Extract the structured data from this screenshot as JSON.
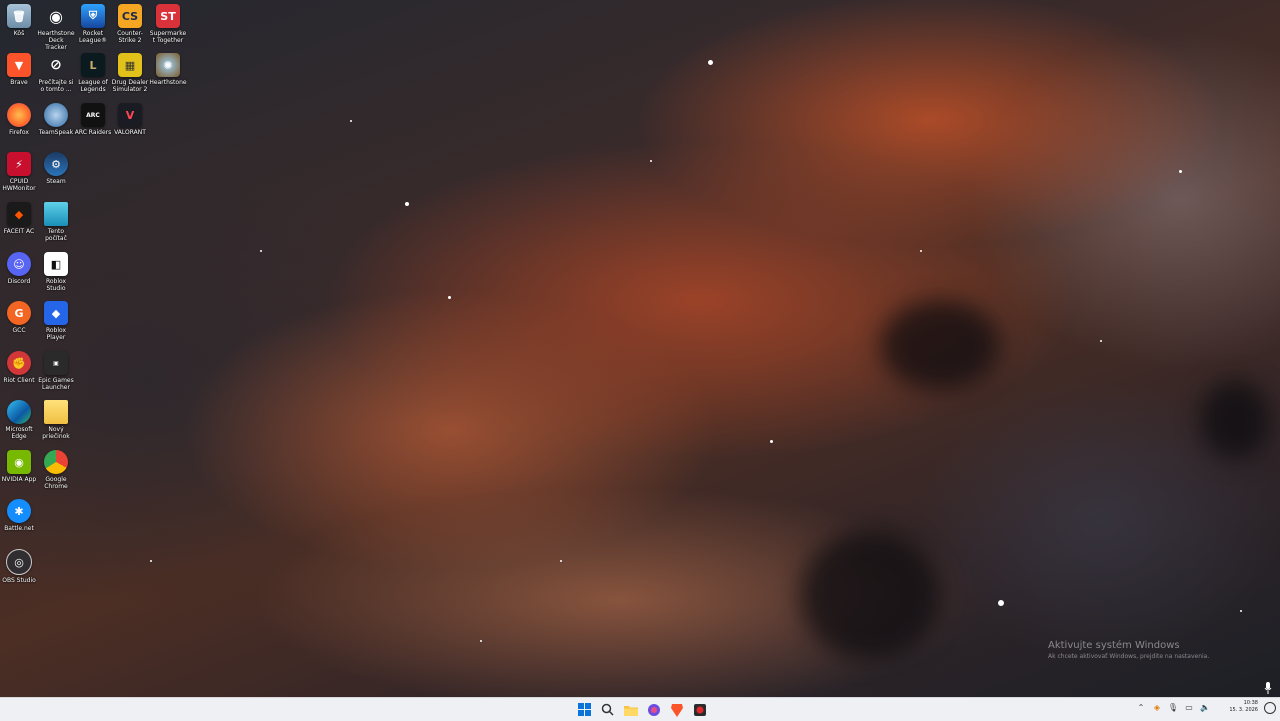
{
  "desktop": {
    "icons": [
      {
        "label": "Kôš"
      },
      {
        "label": "Hearthstone Deck Tracker"
      },
      {
        "label": "Rocket League®"
      },
      {
        "label": "Counter-Strike 2"
      },
      {
        "label": "Supermarket Together"
      },
      {
        "label": "Brave"
      },
      {
        "label": "Prečítajte si o tomto ..."
      },
      {
        "label": "League of Legends"
      },
      {
        "label": "Drug Dealer Simulator 2"
      },
      {
        "label": "Hearthstone"
      },
      {
        "label": "Firefox"
      },
      {
        "label": "TeamSpeak"
      },
      {
        "label": "ARC Raiders"
      },
      {
        "label": "VALORANT"
      },
      {
        "label": "CPUID HWMonitor"
      },
      {
        "label": "Steam"
      },
      {
        "label": "FACEIT AC"
      },
      {
        "label": "Tento počítač"
      },
      {
        "label": "Discord"
      },
      {
        "label": "Roblox Studio"
      },
      {
        "label": "GCC"
      },
      {
        "label": "Roblox Player"
      },
      {
        "label": "Riot Client"
      },
      {
        "label": "Epic Games Launcher"
      },
      {
        "label": "Microsoft Edge"
      },
      {
        "label": "Nový priečinok"
      },
      {
        "label": "NVIDIA App"
      },
      {
        "label": "Google Chrome"
      },
      {
        "label": "Battle.net"
      },
      {
        "label": "OBS Studio"
      }
    ]
  },
  "watermark": {
    "title": "Aktivujte systém Windows",
    "subtitle": "Ak chcete aktivovať Windows, prejdite na nastavenia."
  },
  "taskbar": {
    "clock_time": "10:38",
    "clock_date": "15. 3. 2026"
  }
}
